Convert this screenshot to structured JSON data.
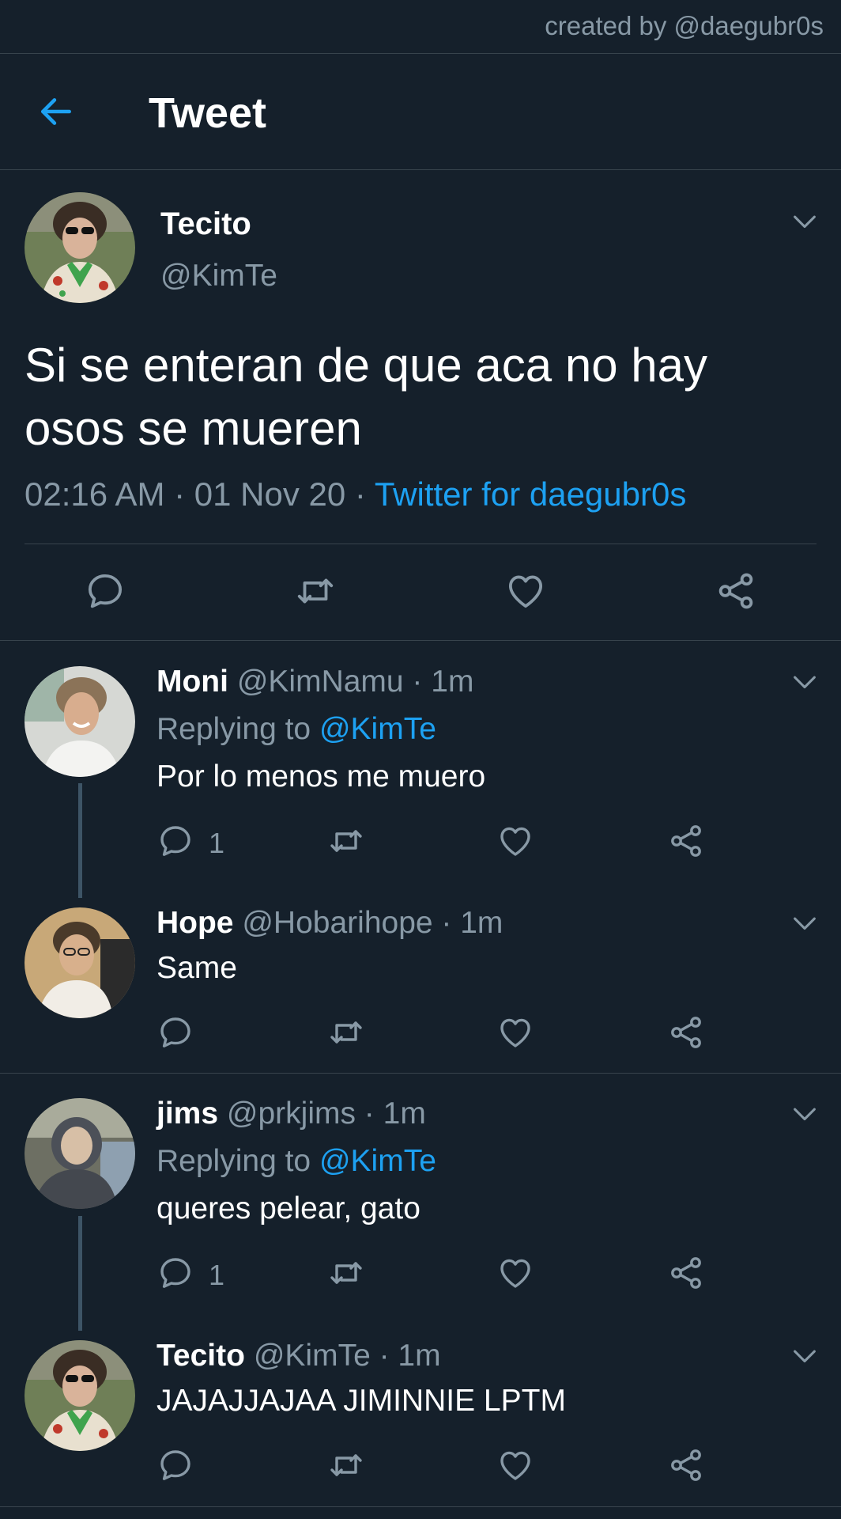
{
  "credit": "created by @daegubr0s",
  "header": {
    "title": "Tweet"
  },
  "main_tweet": {
    "name": "Tecito",
    "handle": "@KimTe",
    "text_line1": "Si se enteran de que aca no hay",
    "text_line2": "osos se mueren",
    "meta": "02:16 AM · 01 Nov 20 · ",
    "source": "Twitter for daegubr0s"
  },
  "replies": [
    {
      "name": "Moni",
      "handle_time": "@KimNamu · 1m",
      "replying_label": "Replying to ",
      "replying_to": "@KimTe",
      "text": "Por lo menos me muero",
      "reply_count": "1"
    },
    {
      "name": "Hope",
      "handle_time": "@Hobarihope · 1m",
      "text": "Same"
    },
    {
      "name": "jims",
      "handle_time": "@prkjims · 1m",
      "replying_label": "Replying to ",
      "replying_to": "@KimTe",
      "text": "queres pelear, gato",
      "reply_count": "1"
    },
    {
      "name": "Tecito",
      "handle_time": "@KimTe · 1m",
      "text": "JAJAJJAJAA JIMINNIE LPTM"
    }
  ],
  "colors": {
    "background": "#15202b",
    "accent": "#1da1f2",
    "secondary_text": "#8899a6",
    "divider": "#38444d"
  },
  "icons": [
    "arrow-left-icon",
    "chevron-down-icon",
    "reply-icon",
    "retweet-icon",
    "like-icon",
    "share-icon"
  ]
}
